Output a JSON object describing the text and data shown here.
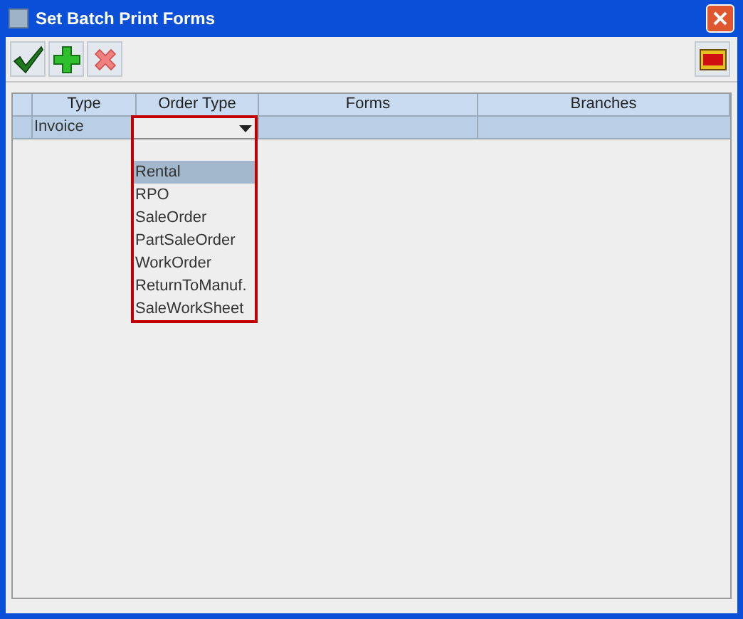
{
  "window": {
    "title": "Set Batch Print Forms"
  },
  "toolbar": [
    {
      "kind": "check"
    },
    {
      "kind": "add"
    },
    {
      "kind": "delete"
    }
  ],
  "table": {
    "columns": [
      "Type",
      "Order Type",
      "Forms",
      "Branches"
    ],
    "rows": [
      {
        "type": "Invoice",
        "selected": true
      }
    ]
  },
  "dropdown": {
    "options": [
      {
        "label": "Rental",
        "selected": true
      },
      {
        "label": "RPO",
        "selected": false
      },
      {
        "label": "SaleOrder",
        "selected": false
      },
      {
        "label": "PartSaleOrder",
        "selected": false
      },
      {
        "label": "WorkOrder",
        "selected": false
      },
      {
        "label": "ReturnToManuf.",
        "selected": false
      },
      {
        "label": "SaleWorkSheet",
        "selected": false
      }
    ]
  }
}
